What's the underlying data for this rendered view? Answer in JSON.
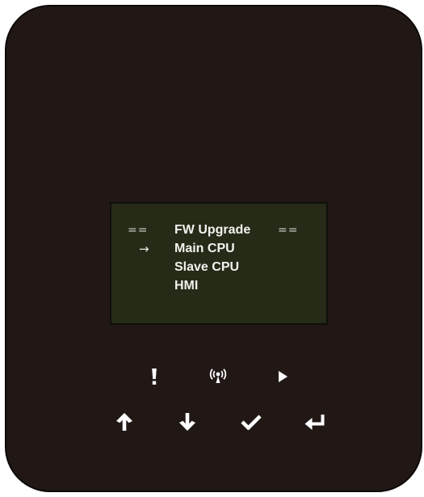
{
  "screen": {
    "header": {
      "decoration_left": "==",
      "title": "FW Upgrade",
      "decoration_right": "=="
    },
    "cursor_symbol": "→",
    "menu_items": [
      {
        "label": "Main CPU",
        "selected": true
      },
      {
        "label": "Slave CPU",
        "selected": false
      },
      {
        "label": "HMI",
        "selected": false
      }
    ]
  },
  "indicators": [
    {
      "name": "alarm",
      "icon": "exclamation-icon"
    },
    {
      "name": "communication",
      "icon": "wireless-signal-icon"
    },
    {
      "name": "run",
      "icon": "play-icon"
    }
  ],
  "keys": [
    {
      "name": "up",
      "icon": "arrow-up-icon"
    },
    {
      "name": "down",
      "icon": "arrow-down-icon"
    },
    {
      "name": "confirm",
      "icon": "checkmark-icon"
    },
    {
      "name": "enter",
      "icon": "return-arrow-icon"
    }
  ],
  "colors": {
    "device_body": "#211816",
    "lcd_background": "#262b18",
    "lcd_text": "#f2f2ee",
    "icon": "#ffffff"
  }
}
